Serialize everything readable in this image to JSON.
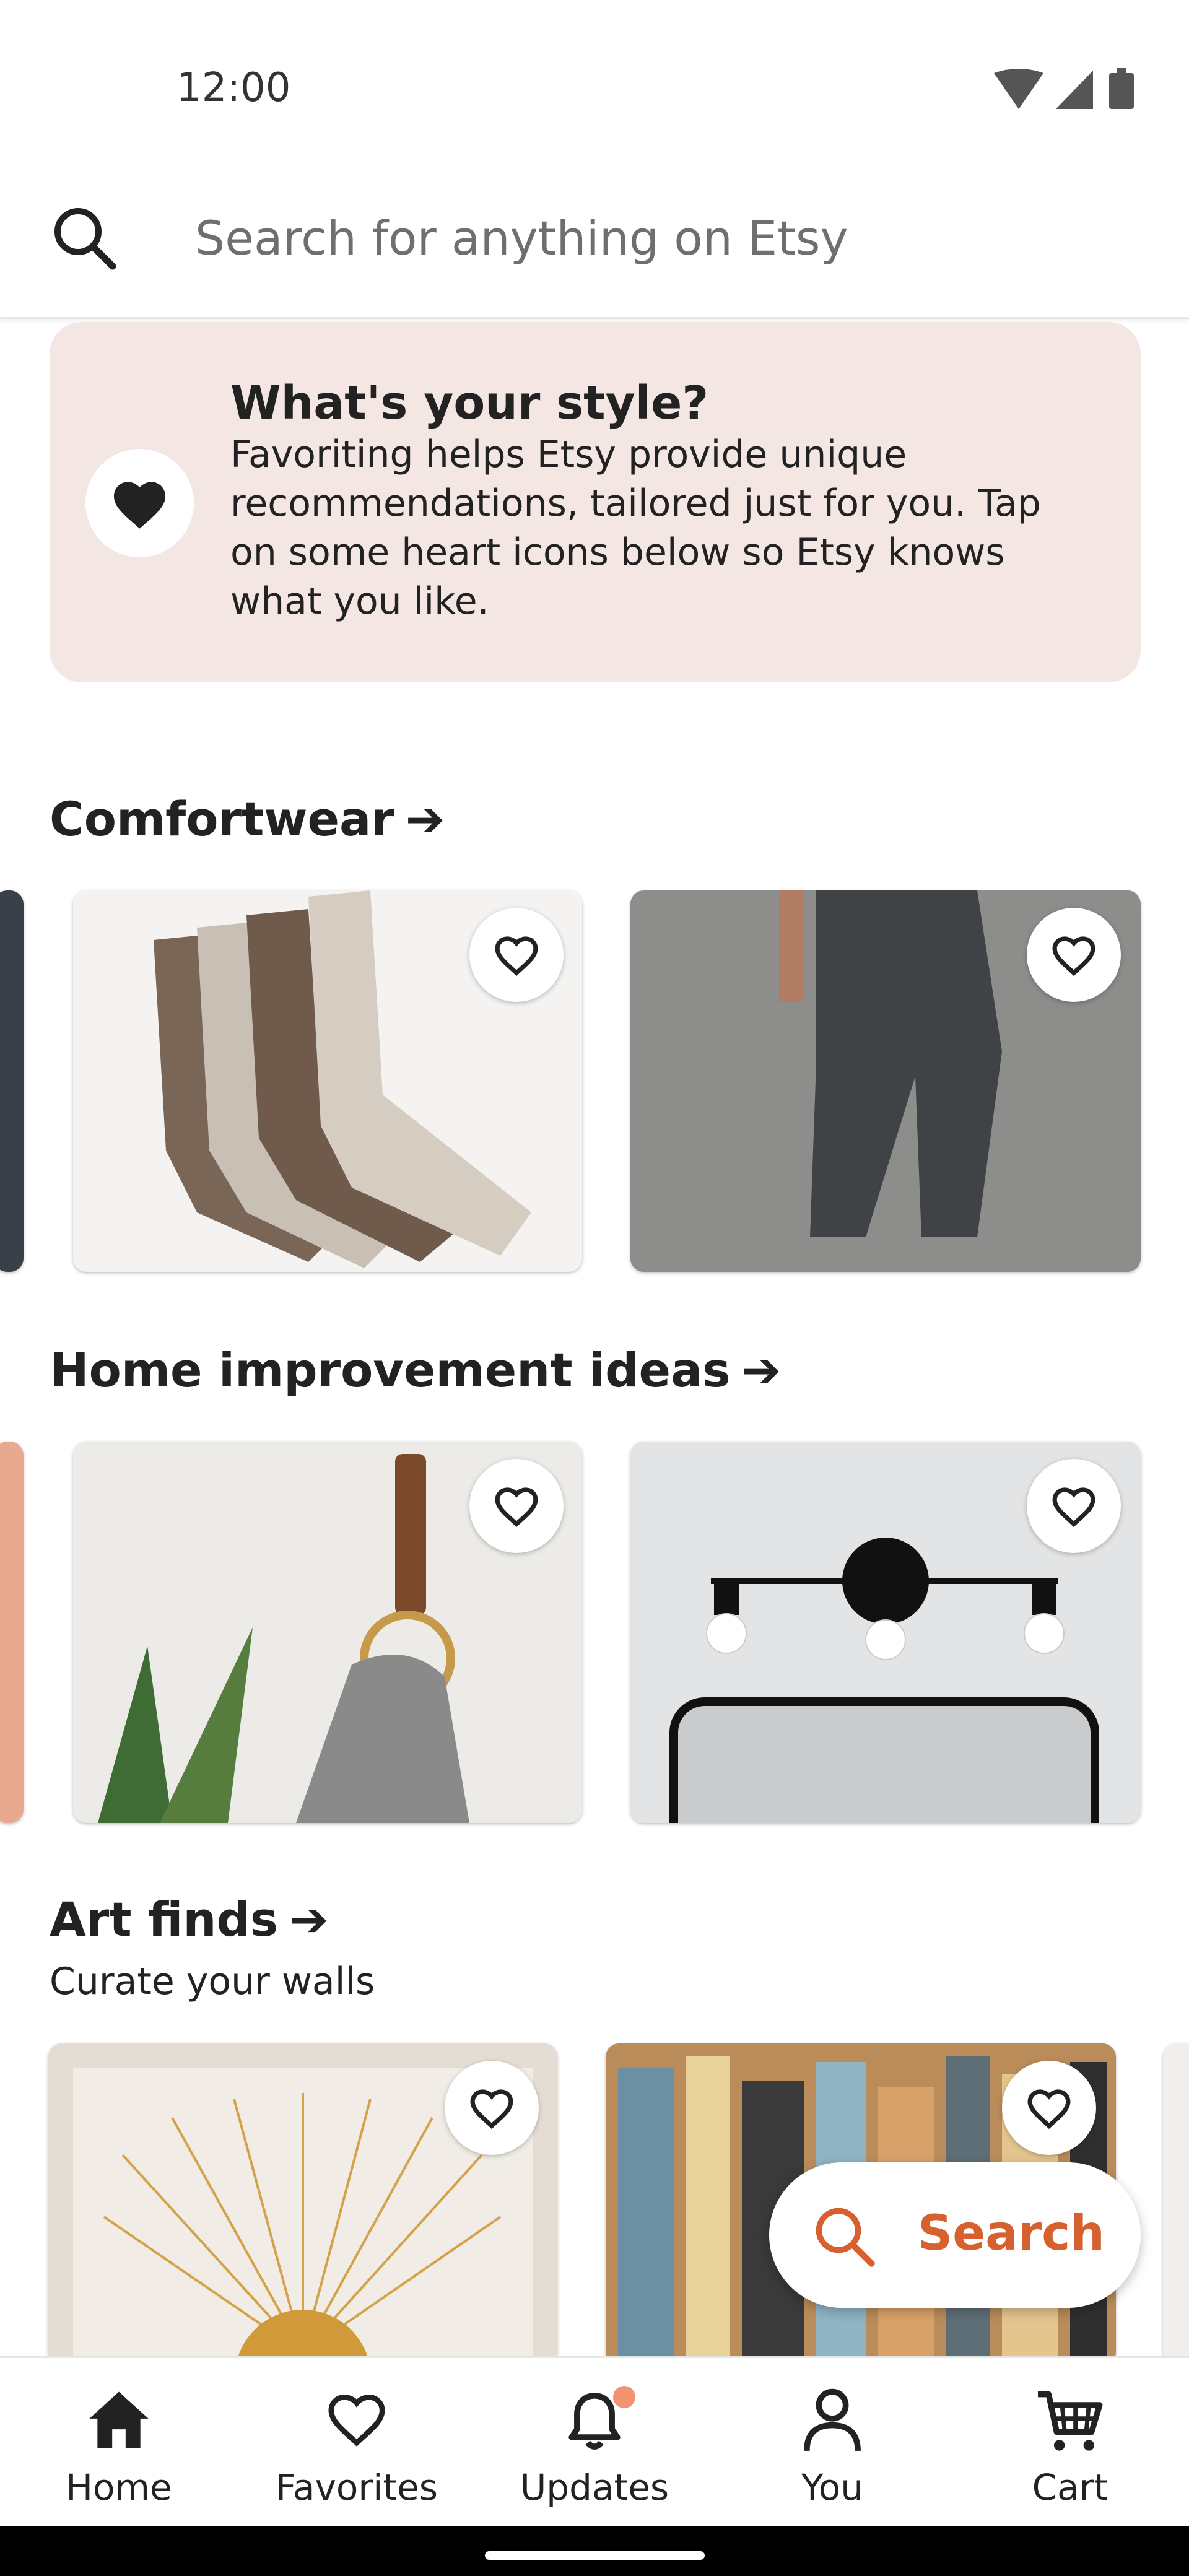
{
  "status_bar": {
    "time": "12:00"
  },
  "search": {
    "placeholder": "Search for anything on Etsy"
  },
  "banner": {
    "title": "What's your style?",
    "body": "Favoriting helps Etsy provide unique recommendations, tailored just for you. Tap on some heart icons below so Etsy knows what you like."
  },
  "sections": [
    {
      "title": "Comfortwear",
      "arrow": "➔"
    },
    {
      "title": "Home improvement ideas",
      "arrow": "➔"
    },
    {
      "title": "Art finds",
      "arrow": "➔",
      "subtitle": "Curate your walls"
    }
  ],
  "fab": {
    "label": "Search"
  },
  "bottom_nav": [
    {
      "label": "Home",
      "icon": "home-icon",
      "active": true
    },
    {
      "label": "Favorites",
      "icon": "heart-outline-icon"
    },
    {
      "label": "Updates",
      "icon": "bell-icon",
      "badge": true
    },
    {
      "label": "You",
      "icon": "person-icon"
    },
    {
      "label": "Cart",
      "icon": "cart-icon"
    }
  ],
  "colors": {
    "accent": "#d6612e",
    "banner_bg": "#f4e6e2",
    "badge": "#f29472"
  }
}
